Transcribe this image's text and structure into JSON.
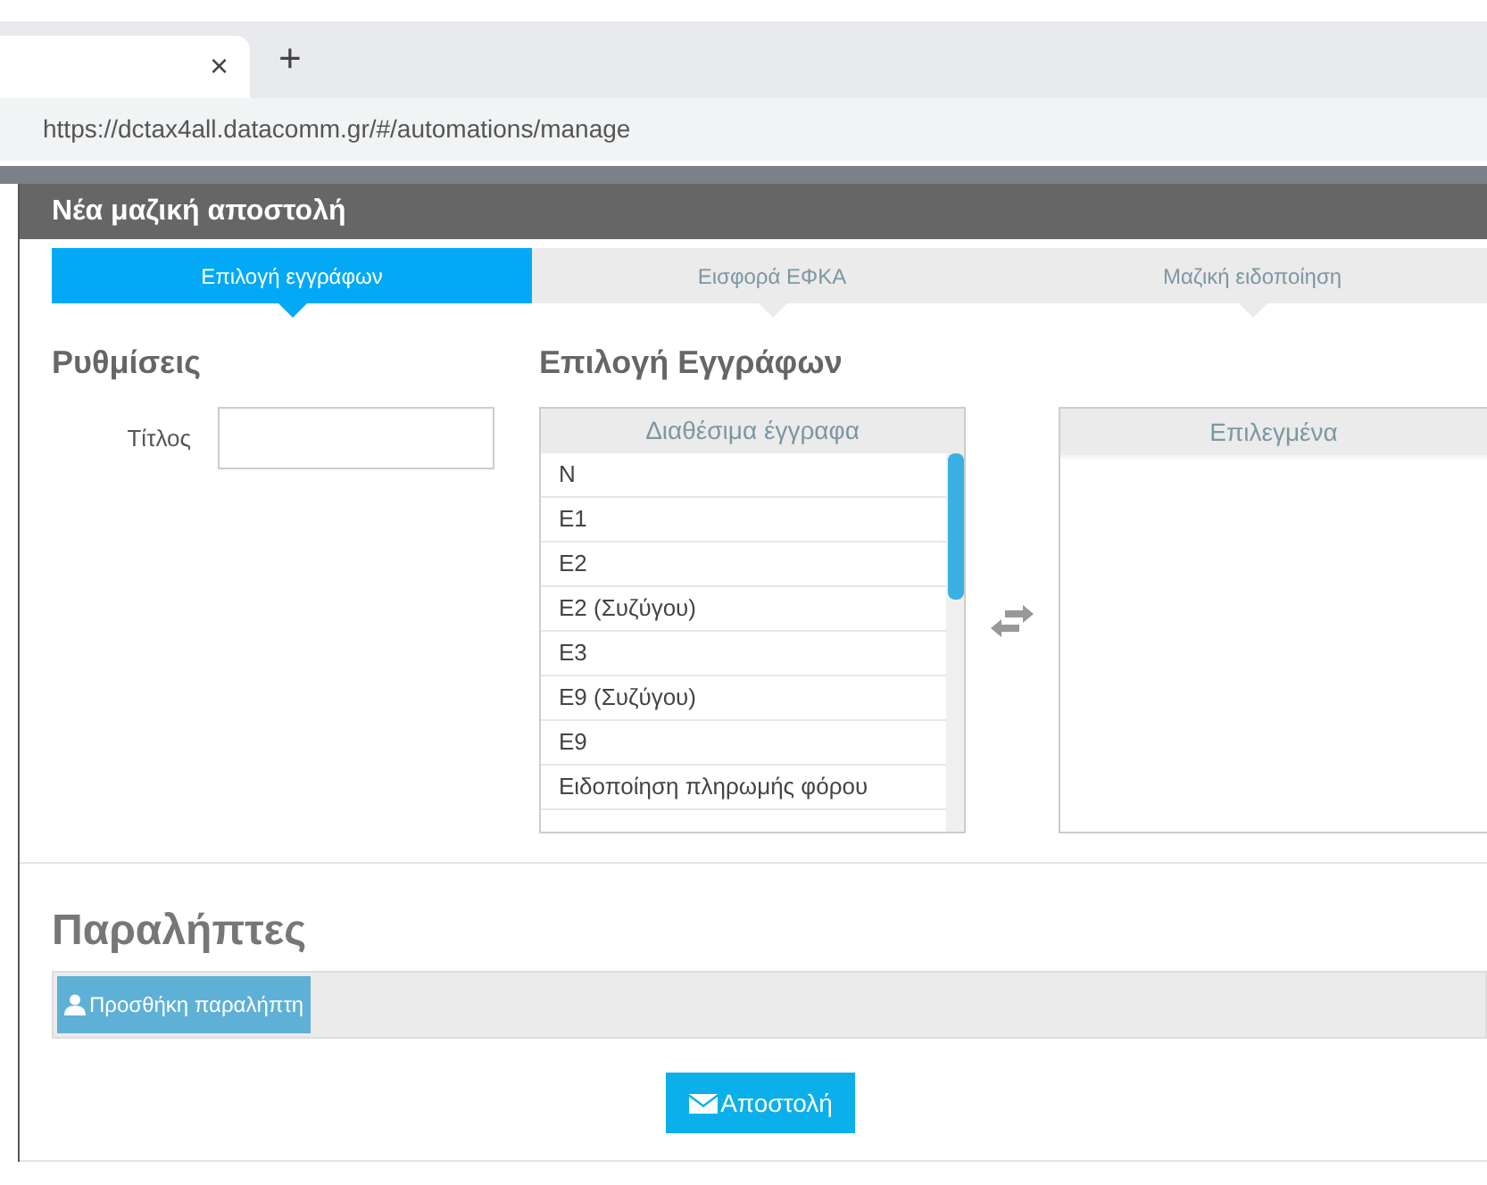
{
  "browser": {
    "tab_close": "×",
    "new_tab": "+",
    "url": "https://dctax4all.datacomm.gr/#/automations/manage"
  },
  "dialog": {
    "title": "Νέα μαζική αποστολή"
  },
  "steps": [
    {
      "label": "Επιλογή εγγράφων",
      "selected": true
    },
    {
      "label": "Εισφορά ΕΦΚΑ",
      "selected": false
    },
    {
      "label": "Μαζική ειδοποίηση",
      "selected": false
    }
  ],
  "settings": {
    "heading": "Ρυθμίσεις",
    "title_label": "Τίτλος"
  },
  "documents": {
    "heading": "Επιλογή Εγγράφων",
    "available_header": "Διαθέσιμα έγγραφα",
    "available": [
      "N",
      "E1",
      "E2",
      "E2 (Συζύγου)",
      "E3",
      "E9 (Συζύγου)",
      "E9",
      "Ειδοποίηση πληρωμής φόρου"
    ],
    "selected_header": "Επιλεγμένα"
  },
  "recipients": {
    "heading": "Παραλήπτες",
    "add_button": "Προσθήκη παραλήπτη"
  },
  "send_button": "Αποστολή"
}
